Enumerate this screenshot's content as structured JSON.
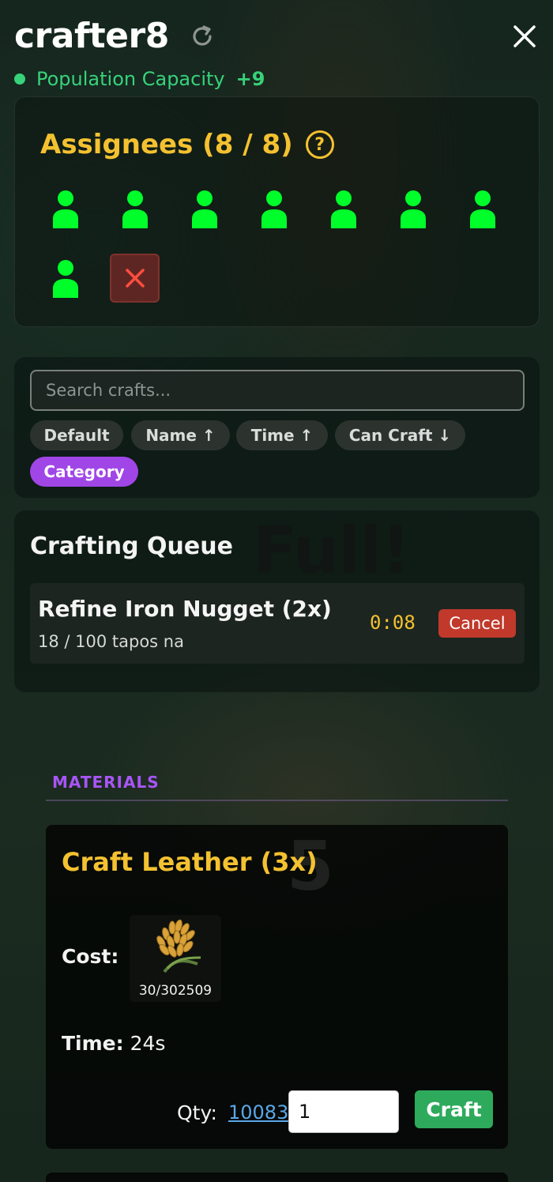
{
  "header": {
    "title": "crafter8"
  },
  "status": {
    "label": "Population Capacity",
    "value": "+9",
    "color": "#37d27a"
  },
  "assignees": {
    "title": "Assignees (8 / 8)",
    "help_symbol": "?",
    "count": 8,
    "worker_color": "#00ff2a"
  },
  "search": {
    "placeholder": "Search crafts..."
  },
  "sort_chips": [
    {
      "label": "Default"
    },
    {
      "label": "Name ↑"
    },
    {
      "label": "Time ↑"
    },
    {
      "label": "Can Craft ↓"
    },
    {
      "label": "Category",
      "active": true
    }
  ],
  "queue": {
    "title": "Crafting Queue",
    "overlay": "Full!",
    "item": {
      "name": "Refine Iron Nugget (2x)",
      "progress": "18 / 100 tapos na",
      "time": "0:08",
      "cancel_label": "Cancel"
    }
  },
  "section": {
    "label": "MATERIALS"
  },
  "recipe": {
    "watermark": "5",
    "title": "Craft Leather (3x)",
    "cost_label": "Cost:",
    "cost_icon": "wheat-icon",
    "cost_count": "30/302509",
    "time_label": "Time:",
    "time_value": "24s",
    "qty_label": "Qty:",
    "qty_max": "10083",
    "qty_value": "1",
    "craft_label": "Craft"
  },
  "colors": {
    "accent_gold": "#f4c130",
    "accent_purple": "#a046e6",
    "danger": "#c0392b",
    "success": "#2eaa5c"
  }
}
